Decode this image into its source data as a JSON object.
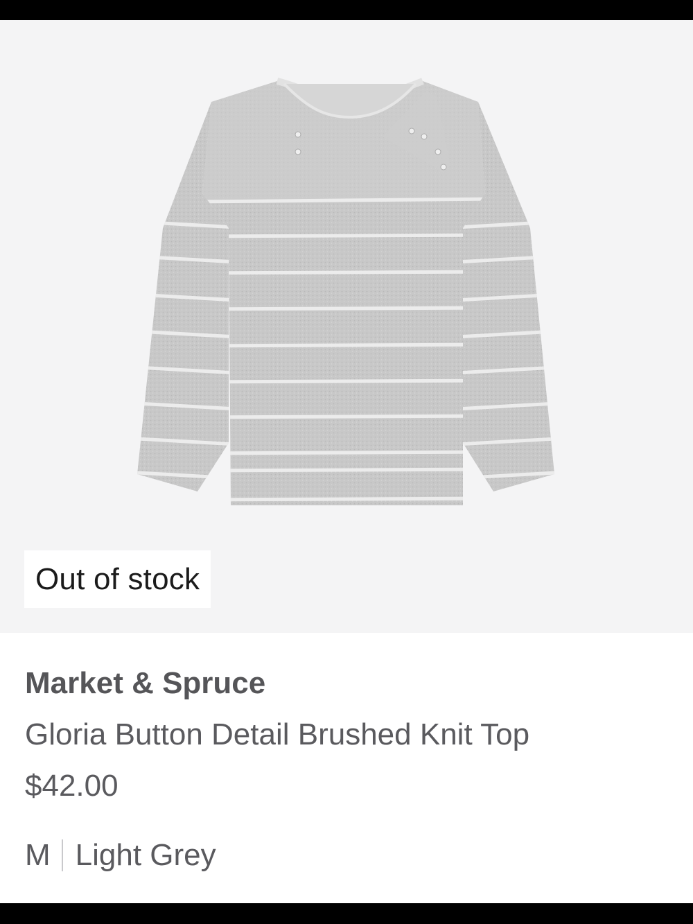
{
  "product": {
    "stock_status": "Out of stock",
    "brand": "Market & Spruce",
    "name": "Gloria Button Detail Brushed Knit Top",
    "price": "$42.00",
    "size": "M",
    "color": "Light Grey"
  },
  "colors": {
    "image_background": "#f4f4f5",
    "sweater": "#c9c9c9",
    "stripe": "#eeeeee",
    "text_primary": "#1b1b1b",
    "text_secondary": "#5a5a5e"
  }
}
